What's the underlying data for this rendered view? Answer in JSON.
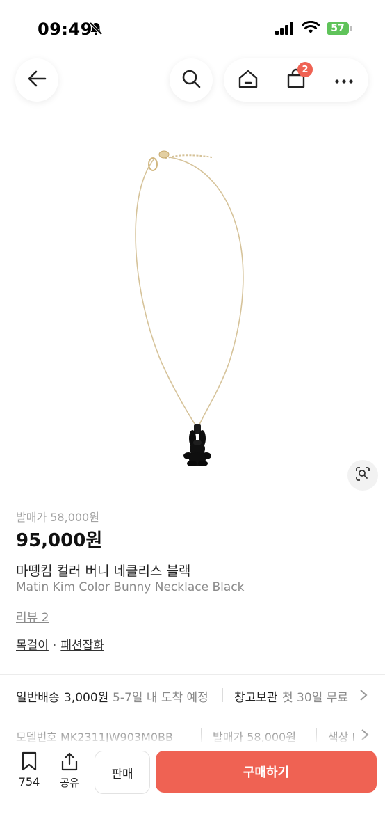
{
  "status_bar": {
    "time": "09:49",
    "battery": "57",
    "icons": [
      "bell-slash-icon",
      "signal-icon",
      "wifi-icon",
      "battery-icon"
    ]
  },
  "nav": {
    "cart_badge": "2",
    "icons": [
      "back-arrow-icon",
      "search-icon",
      "home-icon",
      "shopping-bag-icon",
      "more-icon"
    ]
  },
  "product": {
    "original_price": "발매가 58,000원",
    "price": "95,000원",
    "name_ko": "마뗑킴 컬러 버니 네클리스 블랙",
    "name_en": "Matin Kim Color Bunny Necklace Black",
    "review": "리뷰 2",
    "category_1": "목걸이",
    "category_sep": "·",
    "category_2": "패션잡화"
  },
  "shipping": {
    "type": "일반배송",
    "fee": "3,000원",
    "eta": "5-7일 내 도착 예정",
    "storage": "창고보관",
    "storage_note": "첫 30일 무료"
  },
  "specs": {
    "model": "모델번호 MK2311JW903M0BB",
    "release_price": "발매가 58,000원",
    "color": "색상 I"
  },
  "bottom": {
    "bookmark_count": "754",
    "share_label": "공유",
    "sell_label": "판매",
    "buy_label": "구매하기"
  },
  "colors": {
    "accent": "#ef6253",
    "battery": "#5fc35a"
  }
}
